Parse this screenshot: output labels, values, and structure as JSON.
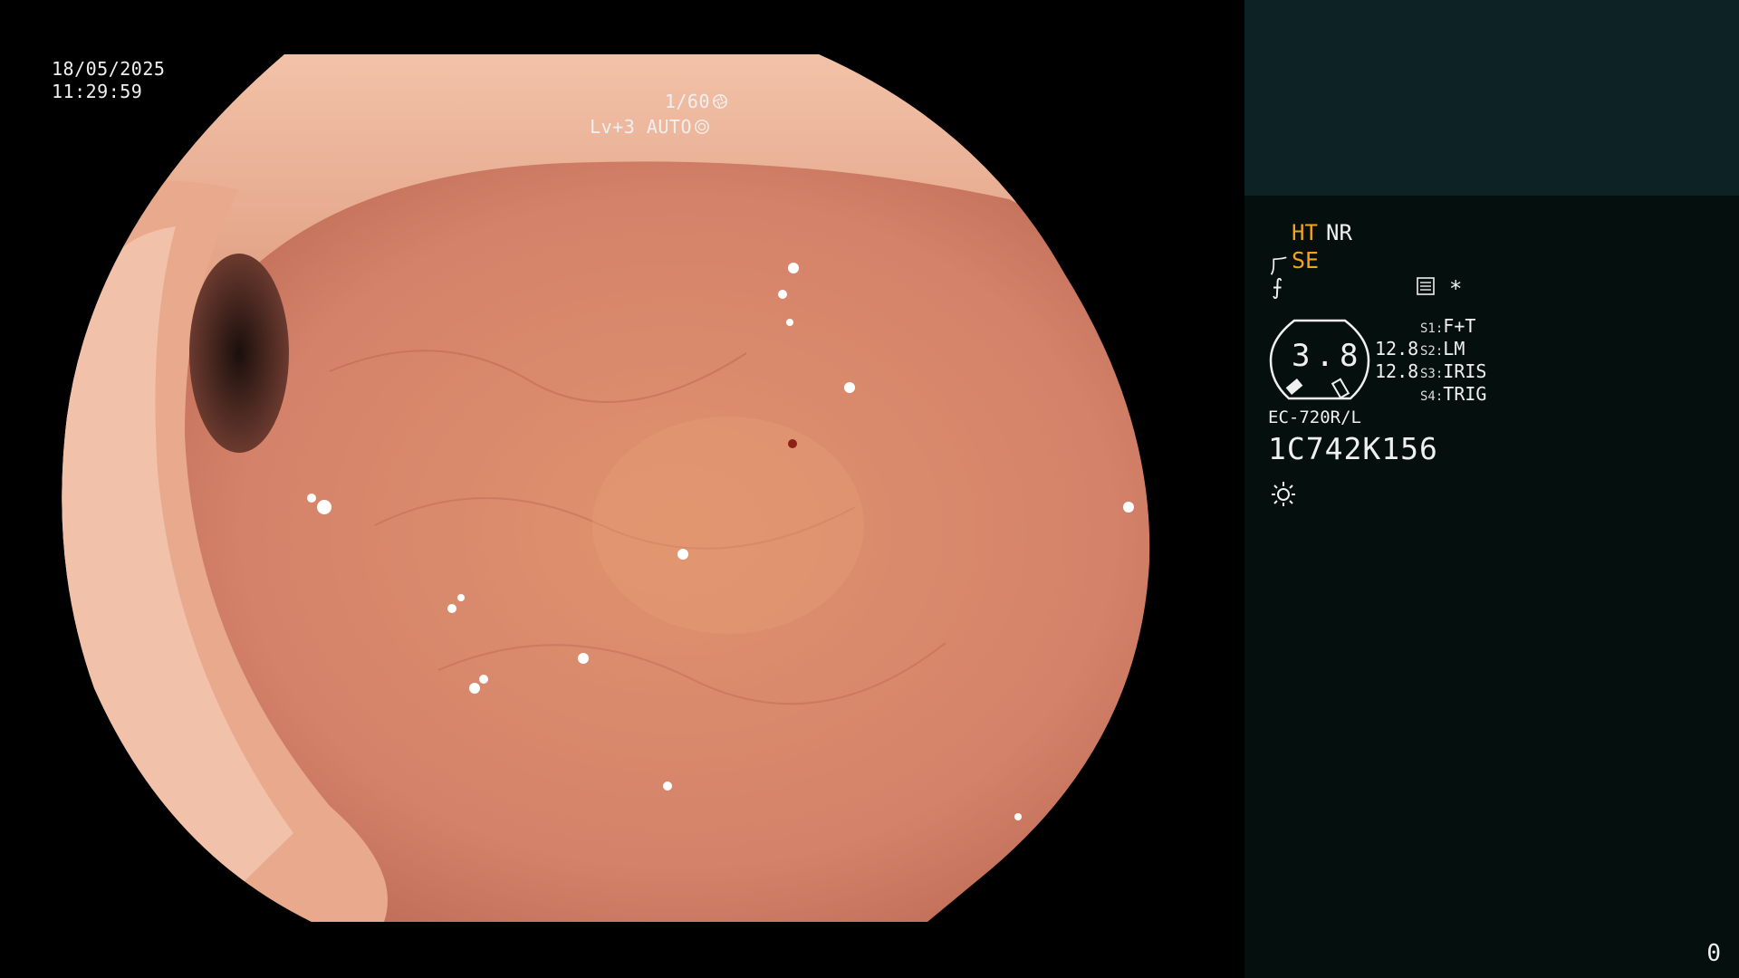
{
  "osd": {
    "date": "18/05/2025",
    "time": "11:29:59",
    "shutter": "1/60",
    "shutter_icon": "shutter-icon",
    "level": "Lv+3 AUTO",
    "auto_icon": "iris-auto-icon"
  },
  "panel": {
    "ht": "HT",
    "nr": "NR",
    "se_icon": "structure-enhancement-icon",
    "se": "SE",
    "freeze_icon": "freeze-icon",
    "menu_icon": "menu-icon",
    "star": "*",
    "gauge_value": "3.8",
    "dist_top": "12.8",
    "dist_bottom": "12.8",
    "switches": [
      {
        "key": "S1:",
        "value": "F+T"
      },
      {
        "key": "S2:",
        "value": "LM"
      },
      {
        "key": "S3:",
        "value": "IRIS"
      },
      {
        "key": "S4:",
        "value": "TRIG"
      }
    ],
    "model": "EC-720R/L",
    "serial": "1C742K156",
    "light_icon": "light-icon",
    "counter": "0"
  },
  "colors": {
    "panel_bg": "#050f0e",
    "panel_top_bg": "#0c2224",
    "accent_orange": "#f4a31a",
    "tissue": "#d9876a"
  }
}
